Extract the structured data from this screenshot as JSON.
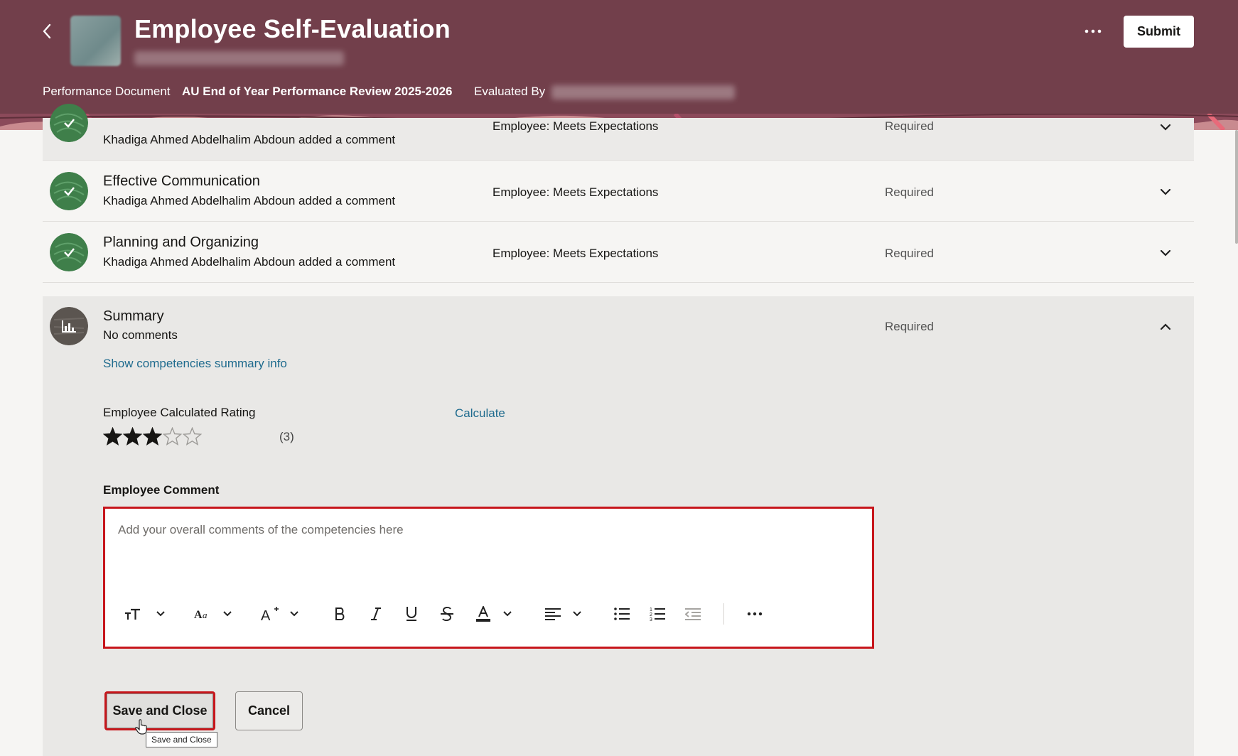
{
  "header": {
    "title": "Employee Self-Evaluation",
    "submit_label": "Submit",
    "performance_document_label": "Performance Document",
    "performance_document_value": "AU End of Year Performance Review 2025-2026",
    "evaluated_by_label": "Evaluated By"
  },
  "sections": [
    {
      "name": "",
      "comment": "Khadiga Ahmed Abdelhalim Abdoun added a comment",
      "rating": "Employee: Meets Expectations",
      "status": "Required"
    },
    {
      "name": "Effective Communication",
      "comment": "Khadiga Ahmed Abdelhalim Abdoun added a comment",
      "rating": "Employee: Meets Expectations",
      "status": "Required"
    },
    {
      "name": "Planning and Organizing",
      "comment": "Khadiga Ahmed Abdelhalim Abdoun added a comment",
      "rating": "Employee: Meets Expectations",
      "status": "Required"
    }
  ],
  "summary": {
    "name": "Summary",
    "comment": "No comments",
    "status": "Required",
    "show_info_link": "Show competencies summary info",
    "calculated_rating_label": "Employee Calculated Rating",
    "calculate_link": "Calculate",
    "rating_value": 3,
    "rating_max": 5,
    "rating_text": "(3)",
    "employee_comment_label": "Employee Comment",
    "editor_placeholder": "Add your overall comments of the competencies here",
    "save_close_label": "Save and Close",
    "cancel_label": "Cancel",
    "tooltip": "Save and Close"
  },
  "colors": {
    "header_bg": "#723f4b",
    "link": "#1f6b8e",
    "highlight": "#c7161c",
    "complete_icon": "#3f7f4a",
    "summary_icon": "#5b5550"
  }
}
